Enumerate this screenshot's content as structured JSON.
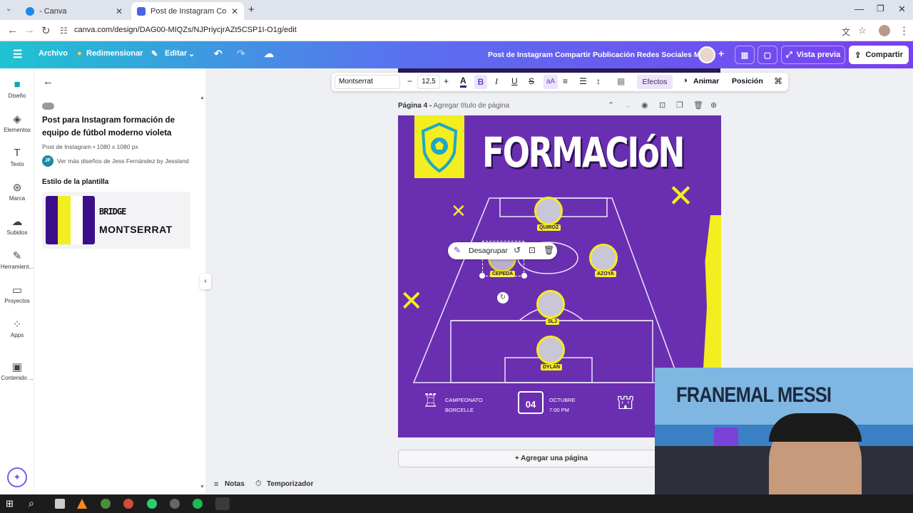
{
  "browser": {
    "tabs": [
      {
        "label": "- Canva"
      },
      {
        "label": "Post de Instagram Compartir P..."
      }
    ],
    "url": "canva.com/design/DAG00-MIQZs/NJPriycjrAZt5CSP1I-O1g/edit"
  },
  "topbar": {
    "archivo": "Archivo",
    "redimensionar": "Redimensionar",
    "editar": "Editar",
    "title": "Post de Instagram Compartir Publicación Redes Sociales M...",
    "vista_previa": "Vista previa",
    "compartir": "Compartir"
  },
  "rail": [
    {
      "label": "Diseño",
      "icon": "design-icon"
    },
    {
      "label": "Elementos",
      "icon": "elements-icon"
    },
    {
      "label": "Texto",
      "icon": "text-icon"
    },
    {
      "label": "Marca",
      "icon": "brand-icon"
    },
    {
      "label": "Subidos",
      "icon": "upload-icon"
    },
    {
      "label": "Herramient...",
      "icon": "tools-icon"
    },
    {
      "label": "Proyectos",
      "icon": "folder-icon"
    },
    {
      "label": "Apps",
      "icon": "apps-icon"
    },
    {
      "label": "Contenido ...",
      "icon": "content-icon"
    }
  ],
  "panel": {
    "template_title": "Post para Instagram formación de equipo de fútbol moderno violeta",
    "meta": "Post de Instagram • 1080 x 1080 px",
    "author_initials": "JF",
    "author_link": "Ver más diseños de Jess Fernández by Jessland",
    "style_heading": "Estilo de la plantilla",
    "font1": "BRIDGE",
    "font2": "MONTSERRAT",
    "palette": [
      "#3c0f8a",
      "#f2ee1f",
      "#ffffff",
      "#3c0f8a"
    ]
  },
  "toolbar": {
    "font": "Montserrat",
    "size": "12,5",
    "efectos": "Efectos",
    "animar": "Animar",
    "posicion": "Posición"
  },
  "page": {
    "label": "Página 4 -",
    "title_placeholder": "Agregar título de página",
    "add_page": "+ Agregar una página"
  },
  "design": {
    "heading": "FORMACIóN",
    "players": [
      {
        "name": "QUIROZ"
      },
      {
        "name": "CEPEDA"
      },
      {
        "name": "AZOYA"
      },
      {
        "name": "SLJ"
      },
      {
        "name": "DYLAN"
      }
    ],
    "context_menu": "Desagrupar",
    "info": {
      "campeonato": "CAMPEONATO",
      "borcelle": "BORCELLE",
      "octubre": "OCTUBRE",
      "hora": "7:00 PM",
      "day": "04"
    }
  },
  "bottom": {
    "notas": "Notas",
    "temporizador": "Temporizador"
  },
  "webcam": {
    "banner": "FRANEMAL MESSI"
  }
}
